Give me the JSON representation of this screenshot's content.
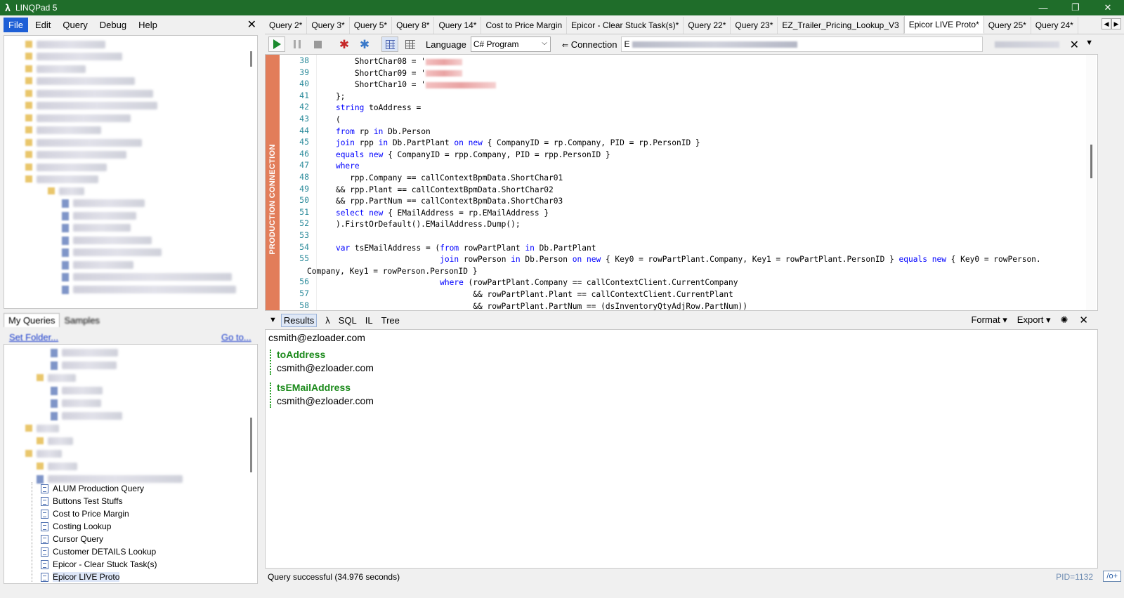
{
  "window": {
    "title": "LINQPad 5",
    "minimize": "—",
    "restore": "❐",
    "close": "✕"
  },
  "menu": {
    "items": [
      "File",
      "Edit",
      "Query",
      "Debug",
      "Help"
    ],
    "close": "✕"
  },
  "left_tabs": {
    "tab1": "My Queries",
    "tab2": "Samples"
  },
  "left_links": {
    "link1": "Set Folder...",
    "link2": "Go to..."
  },
  "query_list": [
    "ALUM Production Query",
    "Buttons Test Stuffs",
    "Cost to Price Margin",
    "Costing Lookup",
    "Cursor Query",
    "Customer DETAILS Lookup",
    "Epicor - Clear Stuck Task(s)",
    "Epicor LIVE Proto"
  ],
  "query_tabs": [
    "Query 2*",
    "Query 3*",
    "Query 5*",
    "Query 8*",
    "Query 14*",
    "Cost to Price Margin",
    "Epicor - Clear Stuck Task(s)*",
    "Query 22*",
    "Query 23*",
    "EZ_Trailer_Pricing_Lookup_V3",
    "Epicor LIVE Proto*",
    "Query 25*",
    "Query 24*"
  ],
  "active_tab_index": 10,
  "toolbar": {
    "language_label": "Language",
    "language_value": "C# Program",
    "connection_label": "Connection",
    "connection_value": "E",
    "close": "✕",
    "dropdown": "▼"
  },
  "editor": {
    "production_banner": "PRODUCTION CONNECTION",
    "line_numbers": [
      "38",
      "39",
      "40",
      "41",
      "42",
      "43",
      "44",
      "45",
      "46",
      "47",
      "48",
      "49",
      "50",
      "51",
      "52",
      "53",
      "54",
      "55",
      "",
      "56",
      "57",
      "58"
    ],
    "lines": [
      "        ShortChar08 = '",
      "        ShortChar09 = '",
      "        ShortChar10 = '",
      "    };",
      "    string toAddress =",
      "    (",
      "    from rp in Db.Person",
      "    join rpp in Db.PartPlant on new { CompanyID = rp.Company, PID = rp.PersonID }",
      "    equals new { CompanyID = rpp.Company, PID = rpp.PersonID }",
      "    where",
      "       rpp.Company == callContextBpmData.ShortChar01",
      "    && rpp.Plant == callContextBpmData.ShortChar02",
      "    && rpp.PartNum == callContextBpmData.ShortChar03",
      "    select new { EMailAddress = rp.EMailAddress }",
      "    ).FirstOrDefault().EMailAddress.Dump();",
      "",
      "    var tsEMailAddress = (from rowPartPlant in Db.PartPlant",
      "                          join rowPerson in Db.Person on new { Key0 = rowPartPlant.Company, Key1 = rowPartPlant.PersonID } equals new { Key0 = rowPerson.",
      "Company, Key1 = rowPerson.PersonID }",
      "                          where (rowPartPlant.Company == callContextClient.CurrentCompany",
      "                                 && rowPartPlant.Plant == callContextClient.CurrentPlant",
      "                                 && rowPartPlant.PartNum == (dsInventoryQtyAdjRow.PartNum))"
    ]
  },
  "results_bar": {
    "tabs": [
      "Results",
      "λ",
      "SQL",
      "IL",
      "Tree"
    ],
    "format": "Format ▾",
    "export": "Export ▾",
    "close": "✕"
  },
  "results": {
    "first_dump": "csmith@ezloader.com",
    "groups": [
      {
        "header": "toAddress",
        "value": "csmith@ezloader.com"
      },
      {
        "header": "tsEMailAddress",
        "value": "csmith@ezloader.com"
      }
    ]
  },
  "status": {
    "message": "Query successful  (34.976 seconds)",
    "pid": "PID=1132",
    "opt": "/o+"
  },
  "colors": {
    "titlebar": "#1f6d2a",
    "production": "#e27d5a",
    "keyword": "#0000ff",
    "result_header": "#1b8a1b"
  }
}
